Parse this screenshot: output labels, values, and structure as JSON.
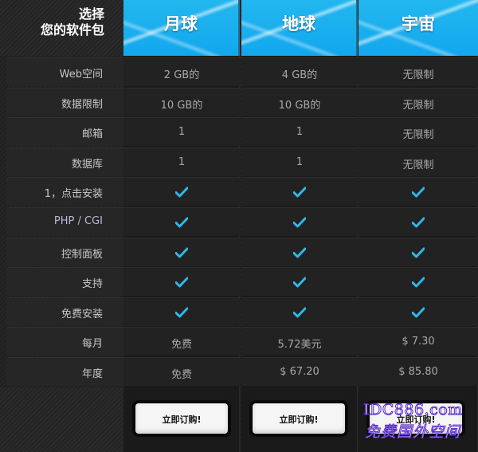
{
  "header": {
    "title": "选择\n您的软件包",
    "plans": [
      "月球",
      "地球",
      "宇宙"
    ]
  },
  "rows": [
    {
      "label": "Web空间",
      "values": [
        "2 GB的",
        "4 GB的",
        "无限制"
      ]
    },
    {
      "label": "数据限制",
      "values": [
        "10 GB的",
        "10 GB的",
        "无限制"
      ]
    },
    {
      "label": "邮箱",
      "values": [
        "1",
        "1",
        "无限制"
      ]
    },
    {
      "label": "数据库",
      "values": [
        "1",
        "1",
        "无限制"
      ]
    },
    {
      "label": "1，点击安装",
      "values": [
        "check-icon",
        "check-icon",
        "check-icon"
      ]
    },
    {
      "label": "PHP / CGI",
      "values": [
        "check-icon",
        "check-icon",
        "check-icon"
      ]
    },
    {
      "label": "控制面板",
      "values": [
        "check-icon",
        "check-icon",
        "check-icon"
      ]
    },
    {
      "label": "支持",
      "values": [
        "check-icon",
        "check-icon",
        "check-icon"
      ]
    },
    {
      "label": "免费安装",
      "values": [
        "check-icon",
        "check-icon",
        "check-icon"
      ]
    },
    {
      "label": "每月",
      "values": [
        "免费",
        "5.72美元",
        "$ 7.30"
      ]
    },
    {
      "label": "年度",
      "values": [
        "免费",
        "$ 67.20",
        "$ 85.80"
      ]
    }
  ],
  "buy_label": "立即订购!",
  "watermark": {
    "line1": "IDC886.com",
    "line2": "免费国外空间"
  },
  "colors": {
    "accent": "#14a9ee",
    "check": "#2fb8ea"
  }
}
